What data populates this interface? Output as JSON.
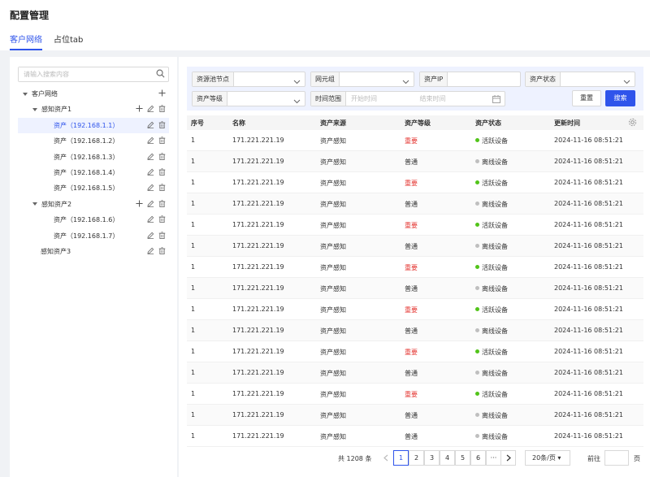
{
  "page": {
    "title": "配置管理"
  },
  "tabs": [
    {
      "label": "客户网络",
      "active": true
    },
    {
      "label": "占位tab",
      "active": false
    }
  ],
  "tree": {
    "search_placeholder": "请输入搜索内容",
    "root": "客户网络",
    "groups": [
      {
        "label": "感知资产1",
        "children": [
          "资产（192.168.1.1）",
          "资产（192.168.1.2）",
          "资产（192.168.1.3）",
          "资产（192.168.1.4）",
          "资产（192.168.1.5）"
        ]
      },
      {
        "label": "感知资产2",
        "children": [
          "资产（192.168.1.6）",
          "资产（192.168.1.7）"
        ]
      },
      {
        "label": "感知资产3",
        "children": []
      }
    ]
  },
  "filters": {
    "pool_node": {
      "label": "资源池节点",
      "value": ""
    },
    "net_group": {
      "label": "网元组",
      "value": ""
    },
    "asset_ip": {
      "label": "资产IP",
      "value": ""
    },
    "asset_status": {
      "label": "资产状态",
      "value": ""
    },
    "asset_level": {
      "label": "资产等级",
      "value": ""
    },
    "time_range": {
      "label": "时间范围",
      "start_placeholder": "开始时间",
      "end_placeholder": "结束时间"
    },
    "reset_label": "重置",
    "search_label": "搜索"
  },
  "table": {
    "columns": [
      "序号",
      "名称",
      "资产来源",
      "资产等级",
      "资产状态",
      "更新时间"
    ],
    "rows": [
      [
        "1",
        "171.221.221.19",
        "资产感知",
        "重要",
        "活跃设备",
        "2024-11-16 08:51:21"
      ],
      [
        "1",
        "171.221.221.19",
        "资产感知",
        "普通",
        "离线设备",
        "2024-11-16 08:51:21"
      ],
      [
        "1",
        "171.221.221.19",
        "资产感知",
        "重要",
        "活跃设备",
        "2024-11-16 08:51:21"
      ],
      [
        "1",
        "171.221.221.19",
        "资产感知",
        "普通",
        "离线设备",
        "2024-11-16 08:51:21"
      ],
      [
        "1",
        "171.221.221.19",
        "资产感知",
        "重要",
        "活跃设备",
        "2024-11-16 08:51:21"
      ],
      [
        "1",
        "171.221.221.19",
        "资产感知",
        "普通",
        "离线设备",
        "2024-11-16 08:51:21"
      ],
      [
        "1",
        "171.221.221.19",
        "资产感知",
        "重要",
        "活跃设备",
        "2024-11-16 08:51:21"
      ],
      [
        "1",
        "171.221.221.19",
        "资产感知",
        "普通",
        "离线设备",
        "2024-11-16 08:51:21"
      ],
      [
        "1",
        "171.221.221.19",
        "资产感知",
        "重要",
        "活跃设备",
        "2024-11-16 08:51:21"
      ],
      [
        "1",
        "171.221.221.19",
        "资产感知",
        "普通",
        "离线设备",
        "2024-11-16 08:51:21"
      ],
      [
        "1",
        "171.221.221.19",
        "资产感知",
        "重要",
        "活跃设备",
        "2024-11-16 08:51:21"
      ],
      [
        "1",
        "171.221.221.19",
        "资产感知",
        "普通",
        "离线设备",
        "2024-11-16 08:51:21"
      ],
      [
        "1",
        "171.221.221.19",
        "资产感知",
        "重要",
        "活跃设备",
        "2024-11-16 08:51:21"
      ],
      [
        "1",
        "171.221.221.19",
        "资产感知",
        "普通",
        "离线设备",
        "2024-11-16 08:51:21"
      ],
      [
        "1",
        "171.221.221.19",
        "资产感知",
        "普通",
        "离线设备",
        "2024-11-16 08:51:21"
      ]
    ]
  },
  "pager": {
    "total": "共 1208 条",
    "pages": [
      "1",
      "2",
      "3",
      "4",
      "5",
      "6",
      "···"
    ],
    "current": "1",
    "page_size": "20条/页",
    "goto_label": "前往",
    "page_word": "页"
  },
  "colors": {
    "primary": "#2f54eb",
    "important": "#e53935",
    "active_dot": "#52c41a",
    "offline_dot": "#bfbfbf"
  }
}
